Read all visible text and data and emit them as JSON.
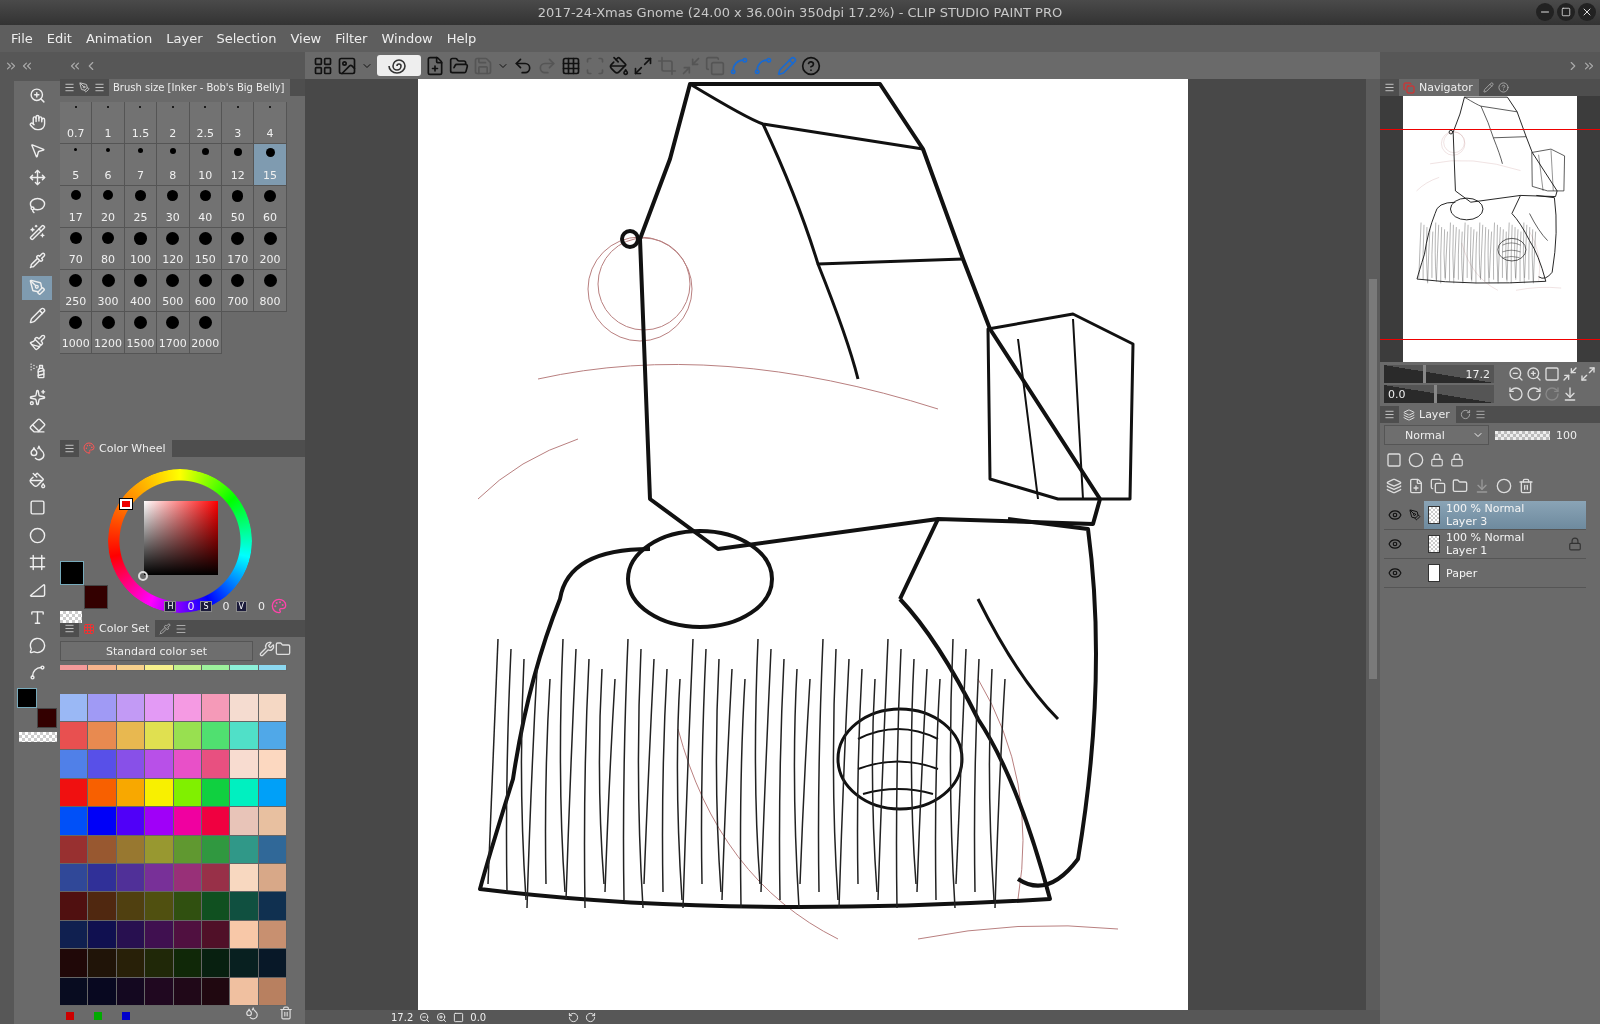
{
  "window": {
    "title": "2017-24-Xmas Gnome (24.00 x 36.00in 350dpi 17.2%)  - CLIP STUDIO PAINT PRO"
  },
  "menu": [
    "File",
    "Edit",
    "Animation",
    "Layer",
    "Selection",
    "View",
    "Filter",
    "Window",
    "Help"
  ],
  "tools": [
    {
      "kind": "zoom",
      "selected": false
    },
    {
      "kind": "hand",
      "selected": false
    },
    {
      "kind": "operation",
      "selected": false
    },
    {
      "kind": "move",
      "selected": false
    },
    {
      "kind": "lasso",
      "selected": false
    },
    {
      "kind": "wand",
      "selected": false
    },
    {
      "kind": "eyedropper",
      "selected": false
    },
    {
      "kind": "pen",
      "selected": true
    },
    {
      "kind": "pencil",
      "selected": false
    },
    {
      "kind": "brush",
      "selected": false
    },
    {
      "kind": "airbrush",
      "selected": false
    },
    {
      "kind": "decoration",
      "selected": false
    },
    {
      "kind": "eraser",
      "selected": false
    },
    {
      "kind": "blend",
      "selected": false
    },
    {
      "kind": "fill",
      "selected": false
    },
    {
      "kind": "gradient",
      "selected": false
    },
    {
      "kind": "figure",
      "selected": false
    },
    {
      "kind": "frame",
      "selected": false
    },
    {
      "kind": "ruler",
      "selected": false
    },
    {
      "kind": "text",
      "selected": false
    },
    {
      "kind": "balloon",
      "selected": false
    },
    {
      "kind": "correct",
      "selected": false
    }
  ],
  "brush_size": {
    "title": "Brush size [Inker - Bob's Big Belly]",
    "sizes": [
      {
        "label": "0.7",
        "selected": false
      },
      {
        "label": "1",
        "selected": false
      },
      {
        "label": "1.5",
        "selected": false
      },
      {
        "label": "2",
        "selected": false
      },
      {
        "label": "2.5",
        "selected": false
      },
      {
        "label": "3",
        "selected": false
      },
      {
        "label": "4",
        "selected": false
      },
      {
        "label": "5",
        "selected": false
      },
      {
        "label": "6",
        "selected": false
      },
      {
        "label": "7",
        "selected": false
      },
      {
        "label": "8",
        "selected": false
      },
      {
        "label": "10",
        "selected": false
      },
      {
        "label": "12",
        "selected": false
      },
      {
        "label": "15",
        "selected": true
      },
      {
        "label": "17",
        "selected": false
      },
      {
        "label": "20",
        "selected": false
      },
      {
        "label": "25",
        "selected": false
      },
      {
        "label": "30",
        "selected": false
      },
      {
        "label": "40",
        "selected": false
      },
      {
        "label": "50",
        "selected": false
      },
      {
        "label": "60",
        "selected": false
      },
      {
        "label": "70",
        "selected": false
      },
      {
        "label": "80",
        "selected": false
      },
      {
        "label": "100",
        "selected": false
      },
      {
        "label": "120",
        "selected": false
      },
      {
        "label": "150",
        "selected": false
      },
      {
        "label": "170",
        "selected": false
      },
      {
        "label": "200",
        "selected": false
      },
      {
        "label": "250",
        "selected": false
      },
      {
        "label": "300",
        "selected": false
      },
      {
        "label": "400",
        "selected": false
      },
      {
        "label": "500",
        "selected": false
      },
      {
        "label": "600",
        "selected": false
      },
      {
        "label": "700",
        "selected": false
      },
      {
        "label": "800",
        "selected": false
      },
      {
        "label": "1000",
        "selected": false
      },
      {
        "label": "1200",
        "selected": false
      },
      {
        "label": "1500",
        "selected": false
      },
      {
        "label": "1700",
        "selected": false
      },
      {
        "label": "2000",
        "selected": false
      }
    ]
  },
  "color_wheel": {
    "title": "Color Wheel",
    "h_label": "H",
    "h": "0",
    "s_label": "S",
    "s": "0",
    "v_label": "V",
    "v": "0",
    "swatches": [
      {
        "kind": "main",
        "color": "#000000"
      },
      {
        "kind": "sub",
        "color": "#330000"
      }
    ]
  },
  "color_set": {
    "title": "Color Set",
    "set_name": "Standard color set",
    "rows": [
      {
        "swatches": [
          {
            "color": "#f49a9a"
          },
          {
            "color": "#f7b48c"
          },
          {
            "color": "#f7d08c"
          },
          {
            "color": "#f7f08c"
          },
          {
            "color": "#c0f08c"
          },
          {
            "color": "#9cf09c"
          },
          {
            "color": "#8cf0d8"
          },
          {
            "color": "#8cd8f0"
          }
        ]
      },
      {
        "swatches": [
          {
            "color": "#9ab8f5"
          },
          {
            "color": "#a09af5"
          },
          {
            "color": "#c29af5"
          },
          {
            "color": "#e39af5"
          },
          {
            "color": "#f59ae3"
          },
          {
            "color": "#f59ab8"
          },
          {
            "color": "#f5dcd0"
          },
          {
            "color": "#f5d8c4"
          }
        ]
      },
      {
        "swatches": [
          {
            "color": "#e85050"
          },
          {
            "color": "#e88a50"
          },
          {
            "color": "#e8b850"
          },
          {
            "color": "#e0e050"
          },
          {
            "color": "#98e050"
          },
          {
            "color": "#50e070"
          },
          {
            "color": "#50e0c8"
          },
          {
            "color": "#50a8e8"
          }
        ]
      },
      {
        "swatches": [
          {
            "color": "#5080e8"
          },
          {
            "color": "#5850e8"
          },
          {
            "color": "#8850e8"
          },
          {
            "color": "#b850e8"
          },
          {
            "color": "#e850c8"
          },
          {
            "color": "#e85080"
          },
          {
            "color": "#f8dcd0"
          },
          {
            "color": "#fcd8c0"
          }
        ]
      },
      {
        "swatches": [
          {
            "color": "#f01010"
          },
          {
            "color": "#f86000"
          },
          {
            "color": "#f8a800"
          },
          {
            "color": "#f8f000"
          },
          {
            "color": "#80f000"
          },
          {
            "color": "#10d040"
          },
          {
            "color": "#00f0c0"
          },
          {
            "color": "#00a0f8"
          }
        ]
      },
      {
        "swatches": [
          {
            "color": "#0050f8"
          },
          {
            "color": "#0000f8"
          },
          {
            "color": "#5000f8"
          },
          {
            "color": "#a000f8"
          },
          {
            "color": "#f000a0"
          },
          {
            "color": "#f00040"
          },
          {
            "color": "#e8c4b8"
          },
          {
            "color": "#e8c0a0"
          }
        ]
      },
      {
        "swatches": [
          {
            "color": "#983030"
          },
          {
            "color": "#985830"
          },
          {
            "color": "#987830"
          },
          {
            "color": "#989830"
          },
          {
            "color": "#609830"
          },
          {
            "color": "#309840"
          },
          {
            "color": "#309888"
          },
          {
            "color": "#306898"
          }
        ]
      },
      {
        "swatches": [
          {
            "color": "#304898"
          },
          {
            "color": "#303098"
          },
          {
            "color": "#503098"
          },
          {
            "color": "#783098"
          },
          {
            "color": "#983078"
          },
          {
            "color": "#983048"
          },
          {
            "color": "#f8d8c0"
          },
          {
            "color": "#d8a888"
          }
        ]
      },
      {
        "swatches": [
          {
            "color": "#501010"
          },
          {
            "color": "#502810"
          },
          {
            "color": "#504010"
          },
          {
            "color": "#505010"
          },
          {
            "color": "#305010"
          },
          {
            "color": "#105020"
          },
          {
            "color": "#105040"
          },
          {
            "color": "#103050"
          }
        ]
      },
      {
        "swatches": [
          {
            "color": "#102050"
          },
          {
            "color": "#101050"
          },
          {
            "color": "#281050"
          },
          {
            "color": "#401050"
          },
          {
            "color": "#501040"
          },
          {
            "color": "#501028"
          },
          {
            "color": "#f8c8a8"
          },
          {
            "color": "#c89070"
          }
        ]
      },
      {
        "swatches": [
          {
            "color": "#200808"
          },
          {
            "color": "#201408"
          },
          {
            "color": "#282008"
          },
          {
            "color": "#202808"
          },
          {
            "color": "#102808"
          },
          {
            "color": "#082010"
          },
          {
            "color": "#082020"
          },
          {
            "color": "#081828"
          }
        ]
      },
      {
        "swatches": [
          {
            "color": "#080c20"
          },
          {
            "color": "#080820"
          },
          {
            "color": "#140820"
          },
          {
            "color": "#200820"
          },
          {
            "color": "#200818"
          },
          {
            "color": "#200810"
          },
          {
            "color": "#f0c0a0"
          },
          {
            "color": "#b88060"
          }
        ]
      }
    ]
  },
  "canvas": {
    "zoom": "17.2",
    "rotation": "0.0"
  },
  "navigator": {
    "title": "Navigator",
    "zoom": "17.2",
    "zoom_slider": {
      "level": 0.35
    },
    "rotation": "0.0",
    "rotation_slider": {
      "level": 0.45
    }
  },
  "layer_panel": {
    "title": "Layer",
    "blend_mode": "Normal",
    "opacity": "100",
    "opacity_slider": {
      "level": 1
    }
  },
  "layers": [
    {
      "kind": "raster",
      "opacity": "100 %",
      "blend": "Normal",
      "name": "Layer 3",
      "visible": true,
      "editing": true,
      "locked": false,
      "selected": true
    },
    {
      "kind": "raster",
      "opacity": "100 %",
      "blend": "Normal",
      "name": "Layer 1",
      "visible": true,
      "editing": false,
      "locked": true,
      "selected": false
    },
    {
      "kind": "paper",
      "name": "Paper",
      "visible": true,
      "editing": false,
      "locked": false,
      "selected": false
    }
  ]
}
